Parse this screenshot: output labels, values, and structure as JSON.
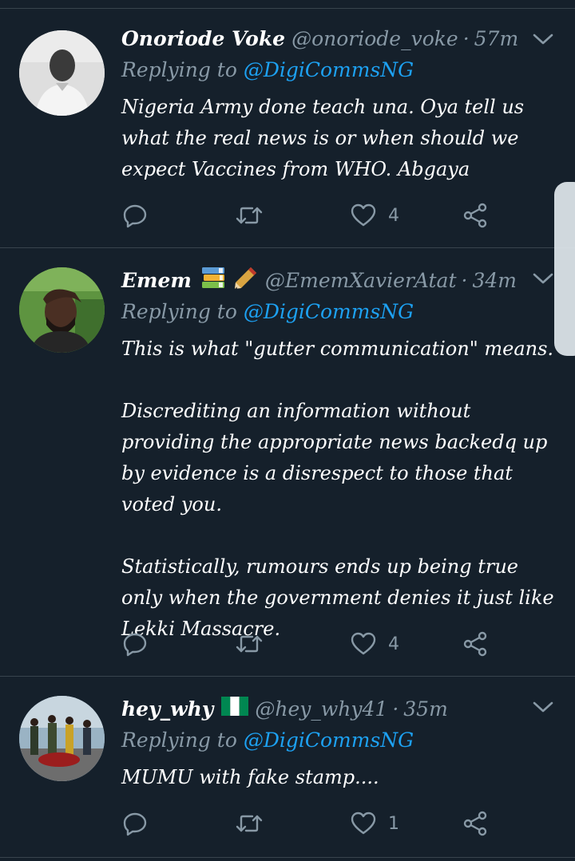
{
  "colors": {
    "background": "#15202b",
    "divider": "#38444d",
    "text_primary": "#ffffff",
    "text_secondary": "#8899a6",
    "mention": "#1da1f2"
  },
  "tweets": [
    {
      "display_name": "Onoriode Voke",
      "handle": "@onoriode_voke",
      "separator": "·",
      "time": "57m",
      "replying_prefix": "Replying to",
      "replying_to": "@DigiCommsNG",
      "text": "Nigeria Army done teach una. Oya tell us what the real news is or when should we expect Vaccines from WHO. Abgaya",
      "reply_count": "",
      "retweet_count": "",
      "like_count": "4",
      "emojis": "",
      "icons": [
        "chevron-down-icon",
        "reply-icon",
        "retweet-icon",
        "heart-icon",
        "share-icon"
      ]
    },
    {
      "display_name": "Emem",
      "handle": "@EmemXavierAtat",
      "separator": "·",
      "time": "34m",
      "replying_prefix": "Replying to",
      "replying_to": "@DigiCommsNG",
      "text": "This is what \"gutter communication\" means.\n\nDiscrediting an information without providing the appropriate news backedq up by evidence is a disrespect to those that voted you.\n\nStatistically, rumours ends up being true only when the government denies it just like Lekki Massacre.",
      "reply_count": "",
      "retweet_count": "",
      "like_count": "4",
      "emojis": "📚🖊",
      "icons": [
        "books-emoji-icon",
        "pen-emoji-icon",
        "chevron-down-icon",
        "reply-icon",
        "retweet-icon",
        "heart-icon",
        "share-icon"
      ]
    },
    {
      "display_name": "hey_why",
      "handle": "@hey_why41",
      "separator": "·",
      "time": "35m",
      "replying_prefix": "Replying to",
      "replying_to": "@DigiCommsNG",
      "text": "MUMU with fake stamp....",
      "reply_count": "",
      "retweet_count": "",
      "like_count": "1",
      "emojis": "",
      "icons": [
        "nigeria-flag-icon",
        "chevron-down-icon",
        "reply-icon",
        "retweet-icon",
        "heart-icon",
        "share-icon"
      ]
    }
  ]
}
